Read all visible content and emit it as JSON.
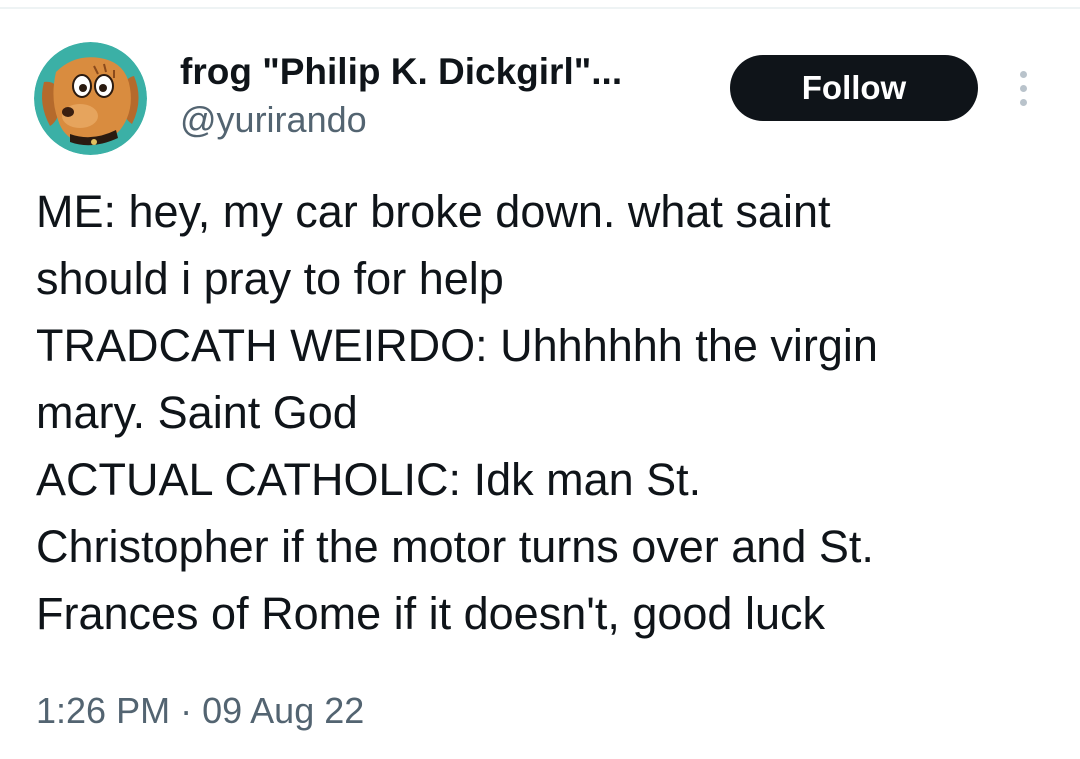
{
  "author": {
    "display_name": "frog \"Philip K. Dickgirl\"...",
    "handle": "@yurirando",
    "avatar_icon": "cartoon-dog-avatar-icon"
  },
  "actions": {
    "follow_label": "Follow",
    "more_icon": "vertical-ellipsis-icon"
  },
  "tweet": {
    "lines": [
      "ME: hey, my car broke down. what saint",
      "should i pray to for help",
      "TRADCATH WEIRDO: Uhhhhhh the virgin",
      "mary. Saint God",
      "ACTUAL CATHOLIC: Idk man St.",
      "Christopher if the motor turns over and St.",
      "Frances of Rome if it doesn't, good luck"
    ]
  },
  "meta": {
    "time": "1:26 PM",
    "separator": "·",
    "date": "09 Aug 22"
  },
  "colors": {
    "text_primary": "#0f1419",
    "text_secondary": "#536471",
    "button_bg": "#0f1419",
    "avatar_bg": "#3bb0a6"
  }
}
